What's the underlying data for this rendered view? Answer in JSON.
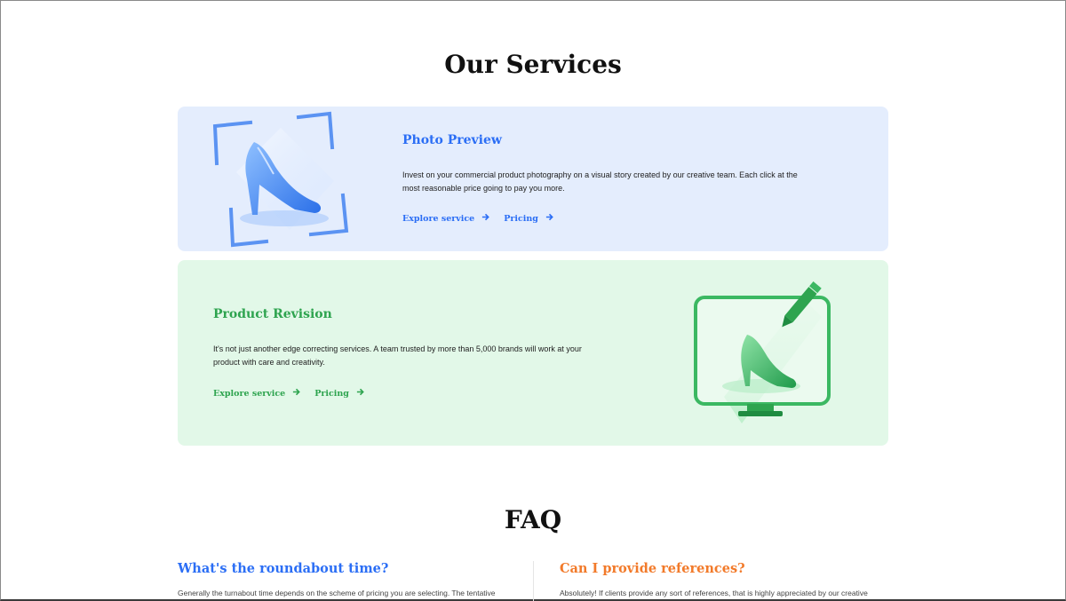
{
  "services": {
    "heading": "Our Services",
    "items": [
      {
        "title": "Photo Preview",
        "description_lines": [
          "Invest on your commercial product photography on a visual story created by our creative team. Each click at the",
          "most reasonable price going to pay you more."
        ],
        "explore_label": "Explore service",
        "pricing_label": "Pricing",
        "accent": "#2b6ef5",
        "background": "#e4edfd",
        "illustration": "high-heel-crop-frame-illustration"
      },
      {
        "title": "Product Revision",
        "description_lines": [
          "It's not just another edge correcting services. A team trusted by more than 5,000 brands will work at your",
          "product with care and creativity."
        ],
        "explore_label": "Explore service",
        "pricing_label": "Pricing",
        "accent": "#2ea44f",
        "background": "#e2f8e8",
        "illustration": "high-heel-monitor-pencil-illustration"
      }
    ]
  },
  "faq": {
    "heading": "FAQ",
    "items": [
      {
        "question": "What's the roundabout time?",
        "answer_preview": "Generally the turnabout time depends on the scheme of pricing you are selecting. The tentative",
        "accent": "#2b6ef5"
      },
      {
        "question": "Can I provide references?",
        "answer_preview": "Absolutely! If clients provide any sort of references, that is highly appreciated by our creative",
        "accent": "#f27a2a"
      }
    ]
  }
}
